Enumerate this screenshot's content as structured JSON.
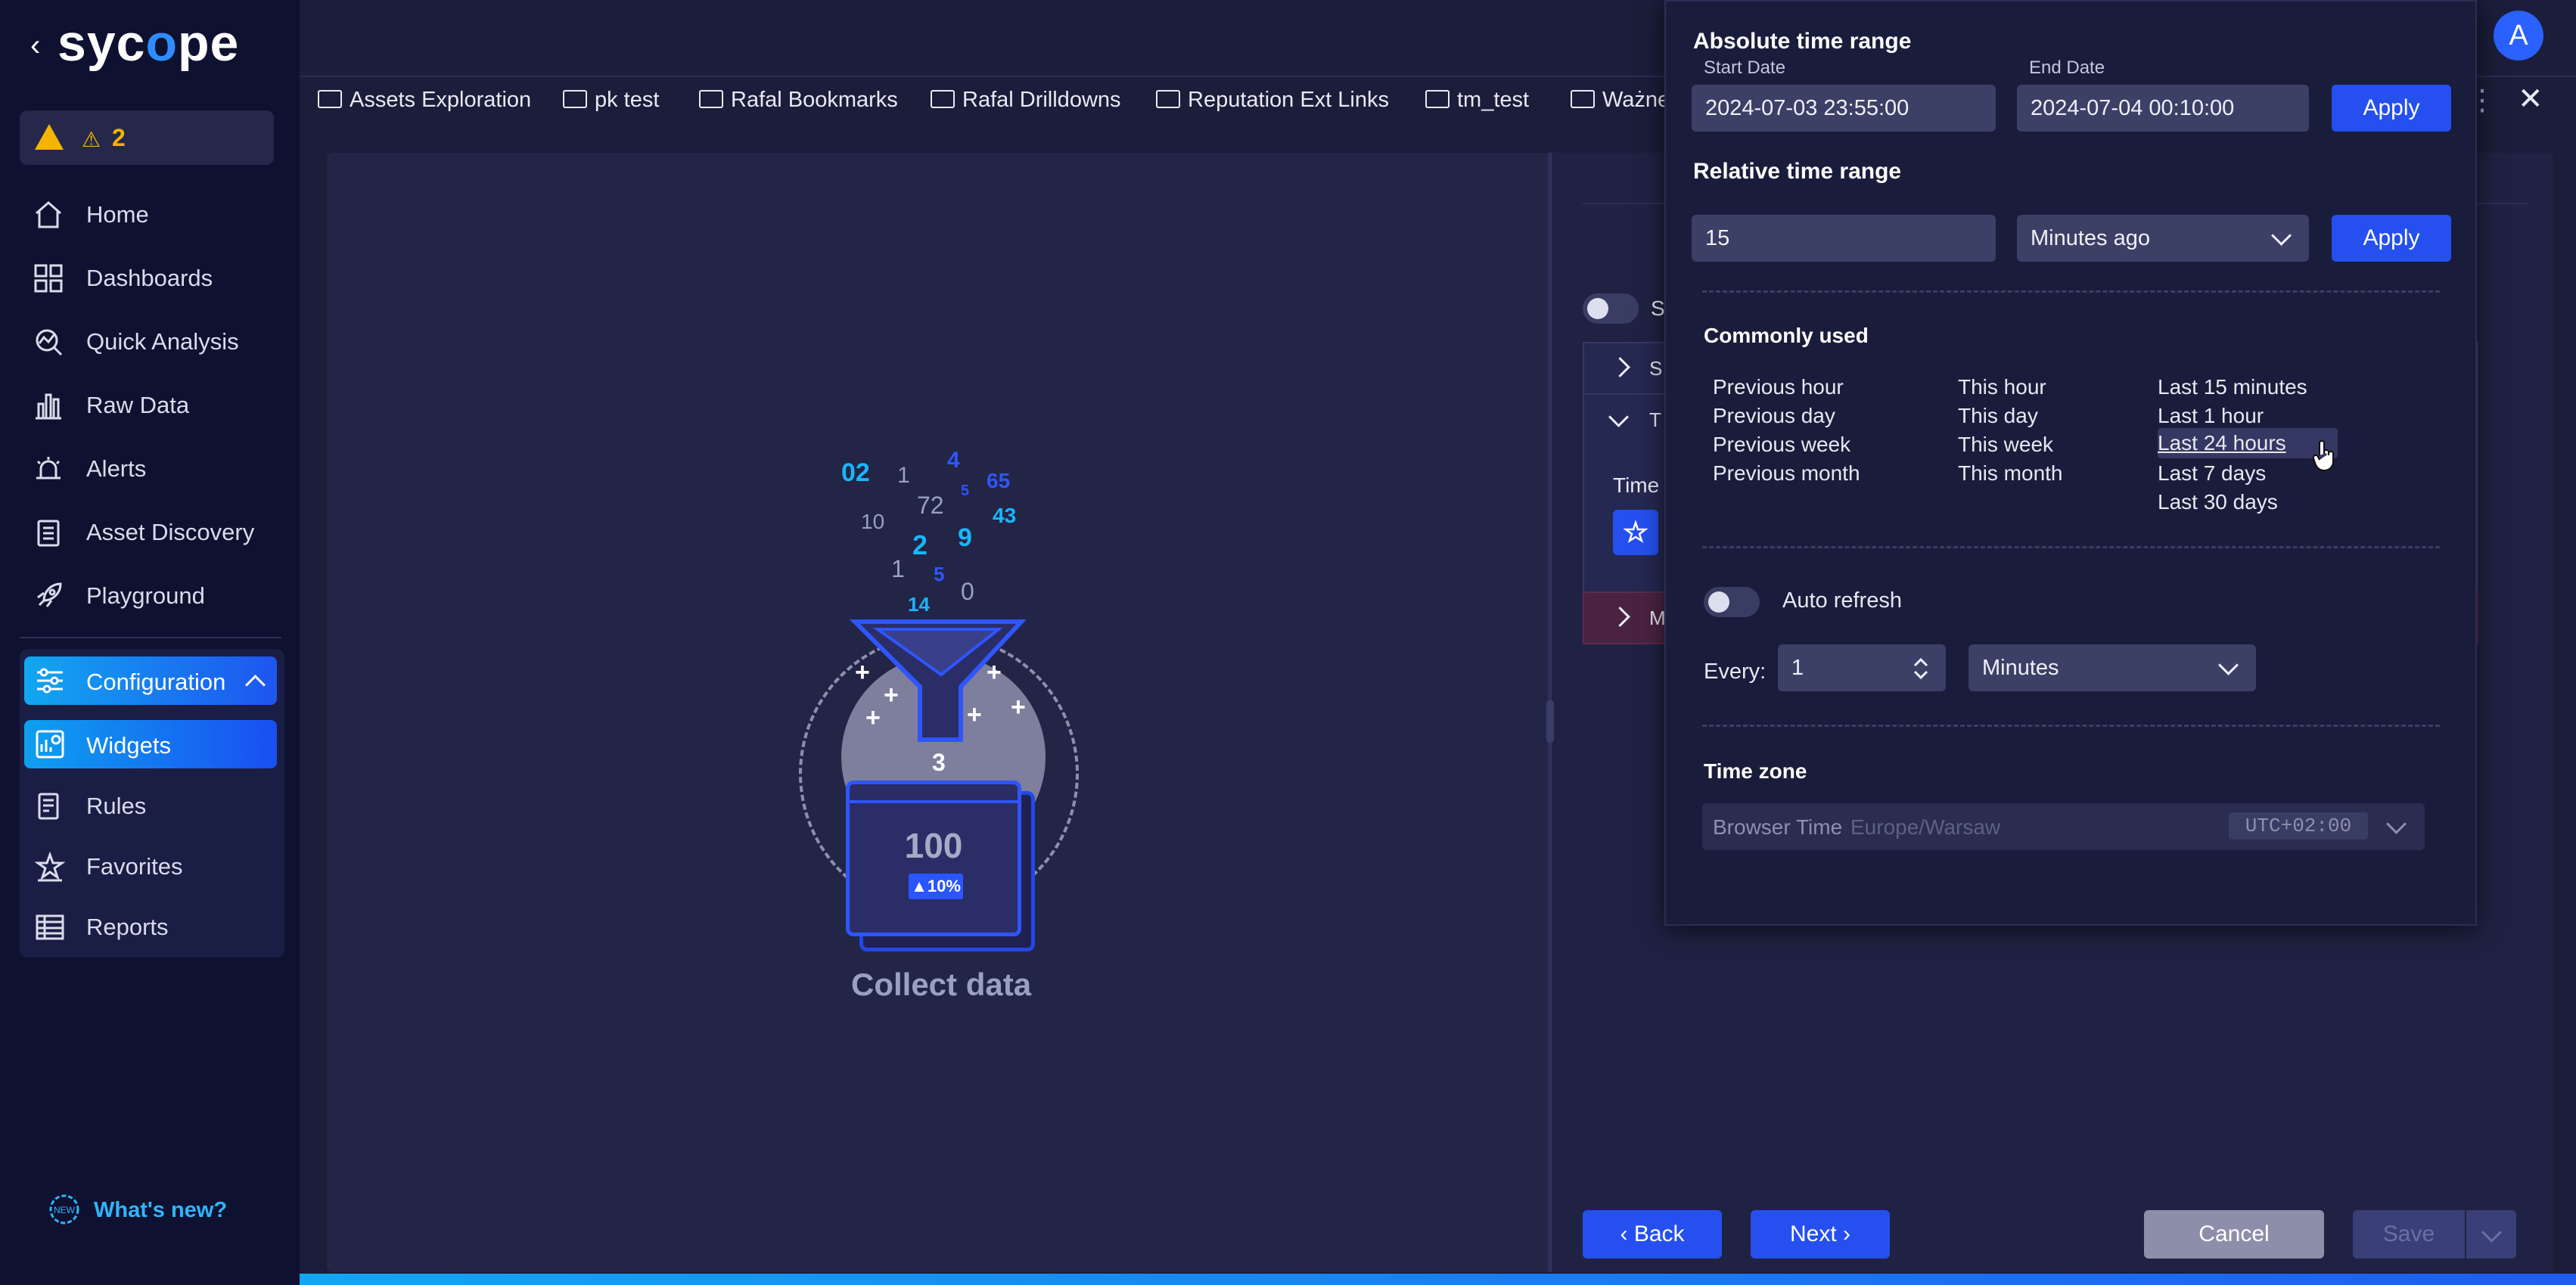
{
  "sidebar": {
    "logo": "syc",
    "logo_o": "o",
    "logo_rest": "pe",
    "alert_count": "2",
    "items": [
      {
        "label": "Home"
      },
      {
        "label": "Dashboards"
      },
      {
        "label": "Quick Analysis"
      },
      {
        "label": "Raw Data"
      },
      {
        "label": "Alerts"
      },
      {
        "label": "Asset Discovery"
      },
      {
        "label": "Playground"
      }
    ],
    "config": {
      "label": "Configuration",
      "sub": [
        {
          "label": "Widgets"
        },
        {
          "label": "Rules"
        },
        {
          "label": "Favorites"
        },
        {
          "label": "Reports"
        }
      ]
    },
    "whats_new": "What's new?"
  },
  "bookmarks": [
    "Assets Exploration",
    "pk test",
    "Rafal Bookmarks",
    "Rafal Drilldowns",
    "Reputation Ext Links",
    "tm_test",
    "Ważne"
  ],
  "user_initial": "A",
  "illustration": {
    "numbers": [
      "02",
      "1",
      "4",
      "65",
      "72",
      "5",
      "10",
      "2",
      "9",
      "43",
      "1",
      "5",
      "0",
      "14"
    ],
    "funnel_output": "3",
    "card_value": "100",
    "card_delta": "▲10%",
    "caption": "Collect data"
  },
  "right_panel": {
    "toggle_label": "S",
    "acc1": "S",
    "acc2": "T",
    "time_label": "Time",
    "acc3": "M"
  },
  "picker": {
    "absolute_title": "Absolute time range",
    "start_label": "Start Date",
    "start_value": "2024-07-03 23:55:00",
    "end_label": "End Date",
    "end_value": "2024-07-04 00:10:00",
    "apply": "Apply",
    "relative_title": "Relative time range",
    "relative_value": "15",
    "relative_unit": "Minutes ago",
    "commonly_title": "Commonly used",
    "col1": [
      "Previous hour",
      "Previous day",
      "Previous week",
      "Previous month"
    ],
    "col2": [
      "This hour",
      "This day",
      "This week",
      "This month"
    ],
    "col3": [
      "Last 15 minutes",
      "Last 1 hour",
      "Last 24 hours",
      "Last 7 days",
      "Last 30 days"
    ],
    "auto_refresh": "Auto refresh",
    "every_label": "Every:",
    "every_value": "1",
    "every_unit": "Minutes",
    "tz_title": "Time zone",
    "tz_browser": "Browser Time",
    "tz_zone": "Europe/Warsaw",
    "tz_offset": "UTC+02:00"
  },
  "footer": {
    "back": "Back",
    "next": "Next",
    "cancel": "Cancel",
    "save": "Save"
  },
  "colors": {
    "accent": "#2550ef",
    "accent_cyan": "#12a6f2",
    "warning": "#f5b400",
    "bg": "#1b1d3a"
  }
}
